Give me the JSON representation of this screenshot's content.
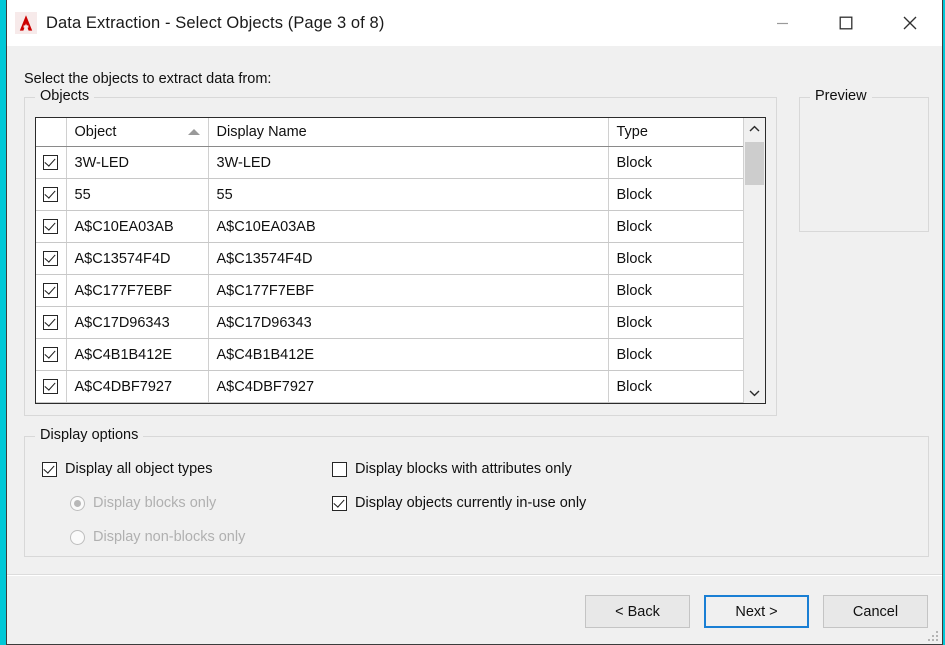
{
  "window": {
    "title": "Data Extraction - Select Objects (Page 3 of 8)",
    "app_icon": "autocad-a-icon",
    "controls": {
      "minimize": "minimize-icon",
      "maximize": "maximize-icon",
      "close": "close-icon"
    },
    "accent_color": "#1a7fd4",
    "logo_color": "#cc0000"
  },
  "instruction": "Select the objects to extract data from:",
  "objects_group": {
    "label": "Objects",
    "columns": [
      "",
      "Object",
      "Display Name",
      "Type"
    ],
    "sort": {
      "column": "Object",
      "direction": "ascending"
    },
    "rows": [
      {
        "checked": true,
        "object": "3W-LED",
        "display_name": "3W-LED",
        "type": "Block"
      },
      {
        "checked": true,
        "object": "55",
        "display_name": "55",
        "type": "Block"
      },
      {
        "checked": true,
        "object": "A$C10EA03AB",
        "display_name": "A$C10EA03AB",
        "type": "Block"
      },
      {
        "checked": true,
        "object": "A$C13574F4D",
        "display_name": "A$C13574F4D",
        "type": "Block"
      },
      {
        "checked": true,
        "object": "A$C177F7EBF",
        "display_name": "A$C177F7EBF",
        "type": "Block"
      },
      {
        "checked": true,
        "object": "A$C17D96343",
        "display_name": "A$C17D96343",
        "type": "Block"
      },
      {
        "checked": true,
        "object": "A$C4B1B412E",
        "display_name": "A$C4B1B412E",
        "type": "Block"
      },
      {
        "checked": true,
        "object": "A$C4DBF7927",
        "display_name": "A$C4DBF7927",
        "type": "Block"
      }
    ],
    "scrollbar": {
      "up_arrow": "chevron-up-icon",
      "down_arrow": "chevron-down-icon"
    }
  },
  "preview_group": {
    "label": "Preview",
    "content": ""
  },
  "display_options": {
    "label": "Display options",
    "options": [
      {
        "type": "checkbox",
        "label": "Display all object types",
        "checked": true,
        "enabled": true
      },
      {
        "type": "radio",
        "label": "Display blocks only",
        "checked": true,
        "enabled": false
      },
      {
        "type": "radio",
        "label": "Display non-blocks only",
        "checked": false,
        "enabled": false
      },
      {
        "type": "checkbox",
        "label": "Display blocks with attributes only",
        "checked": false,
        "enabled": true
      },
      {
        "type": "checkbox",
        "label": "Display objects currently in-use only",
        "checked": true,
        "enabled": true
      }
    ]
  },
  "footer": {
    "back_label": "< Back",
    "next_label": "Next >",
    "cancel_label": "Cancel"
  }
}
